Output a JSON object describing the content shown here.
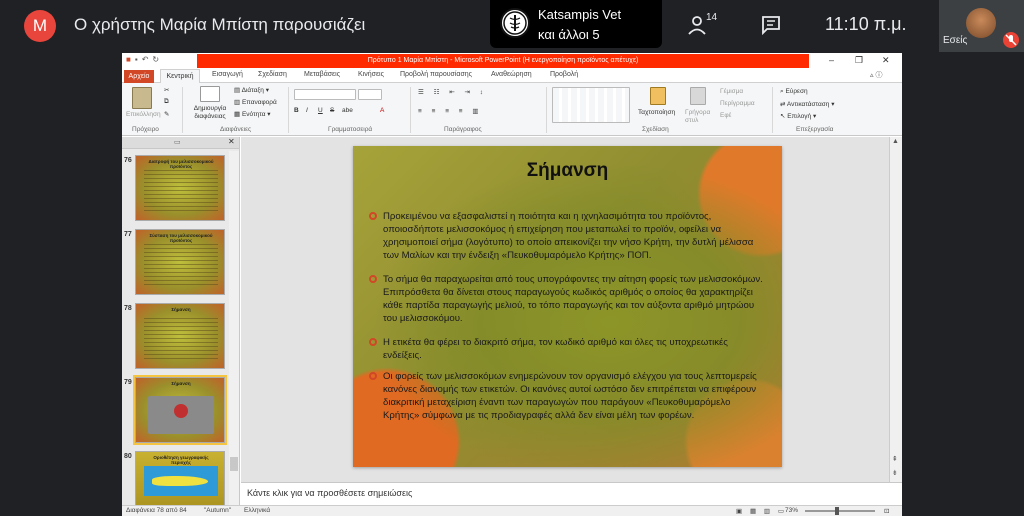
{
  "meet": {
    "presenter_initial": "M",
    "presenting_title": "Ο χρήστης Μαρία Μπίστη παρουσιάζει",
    "speaker_name": "Katsampis Vet",
    "speaker_others": "και άλλοι 5",
    "participants_count": "14",
    "time": "11:10 π.μ.",
    "self_label": "Εσείς",
    "colors": {
      "background": "#202124",
      "avatar": "#e8453c",
      "mic_off": "#ea4335"
    }
  },
  "ppt": {
    "window_title": "Πρότυπο 1 Μαρία Μπίστη  -  Microsoft PowerPoint (Η ενεργοποίηση προϊόντος απέτυχε)",
    "tabs": [
      "Αρχείο",
      "Κεντρική",
      "Εισαγωγή",
      "Σχεδίαση",
      "Μεταβάσεις",
      "Κινήσεις",
      "Προβολή παρουσίασης",
      "Αναθεώρηση",
      "Προβολή"
    ],
    "ribbon": {
      "clipboard": {
        "paste": "Επικόλληση",
        "label": "Πρόχειρο"
      },
      "slides": {
        "new_slide": "Δημιουργία διαφάνειας",
        "layout": "Διάταξη",
        "reset": "Επαναφορά",
        "section": "Ενότητα",
        "label": "Διαφάνειες"
      },
      "font": {
        "label": "Γραμματοσειρά",
        "bold": "B",
        "italic": "I",
        "underline": "U",
        "strike": "S",
        "shadow": "abe",
        "font_color": "A"
      },
      "paragraph": {
        "label": "Παράγραφος"
      },
      "drawing": {
        "arrange": "Ταχτοποίηση",
        "quick_styles": "Γρήγορα στυλ",
        "fill": "Γέμισμα",
        "outline": "Περίγραμμα",
        "effects": "Εφέ",
        "label": "Σχεδίαση"
      },
      "editing": {
        "find": "Εύρεση",
        "replace": "Αντικατάσταση",
        "select": "Επιλογή",
        "label": "Επεξεργασία"
      }
    },
    "thumbnails": [
      {
        "num": "76",
        "title": "Διατροφή του μελισσοκομικού προϊόντος"
      },
      {
        "num": "77",
        "title": "Σύσταση του μελισσοκομικού προϊόντος"
      },
      {
        "num": "78",
        "title": "Σήμανση"
      },
      {
        "num": "79",
        "title": "Σήμανση"
      },
      {
        "num": "80",
        "title": "Οριοθέτηση γεωγραφικής περιοχής"
      }
    ],
    "slide": {
      "title": "Σήμανση",
      "bullets": [
        "Προκειμένου να εξασφαλιστεί η ποιότητα και η ιχνηλασιμότητα του προϊόντος, οποιοσδήποτε μελισσοκόμος ή επιχείρηση που μεταπωλεί το προϊόν, οφείλει να χρησιμοποιεί σήμα (λογότυπο) το οποίο απεικονίζει την νήσο Κρήτη, την δυτλή μέλισσα των Μαλίων και την ένδειξη «Πευκοθυμαρόμελο Κρήτης» ΠΟΠ.",
        "Το σήμα θα παραχωρείται από τους υπογράφοντες την αίτηση φορείς των μελισσοκόμων. Επιπρόσθετα θα δίνεται στους παραγωγούς κωδικός αριθμός ο οποίος θα χαρακτηρίζει κάθε παρτίδα παραγωγής μελιού, το τόπο παραγωγής και τον αύξοντα αριθμό μητρώου του μελισσοκόμου.",
        "Η ετικέτα θα φέρει το διακριτό σήμα, τον κωδικό αριθμό και όλες τις υποχρεωτικές ενδείξεις.",
        "Οι φορείς των μελισσοκόμων ενημερώνουν τον οργανισμό ελέγχου για τους λεπτομερείς κανόνες διανομής των ετικετών. Οι κανόνες αυτοί ωστόσο δεν επιτρέπεται να επιφέρουν διακριτική μεταχείριση έναντι των παραγωγών που παράγουν «Πευκοθυμαρόμελο Κρήτης» σύμφωνα με τις προδιαγραφές αλλά δεν είναι μέλη των φορέων."
      ]
    },
    "notes_placeholder": "Κάντε κλικ για να προσθέσετε σημειώσεις",
    "status": {
      "slide_counter": "Διαφάνεια 78 από 84",
      "theme": "\"Autumn\"",
      "language": "Ελληνικά",
      "zoom": "73%"
    },
    "colors": {
      "title_bar": "#ff2a00",
      "file_tab": "#d24726",
      "bullet": "#d24726"
    }
  }
}
